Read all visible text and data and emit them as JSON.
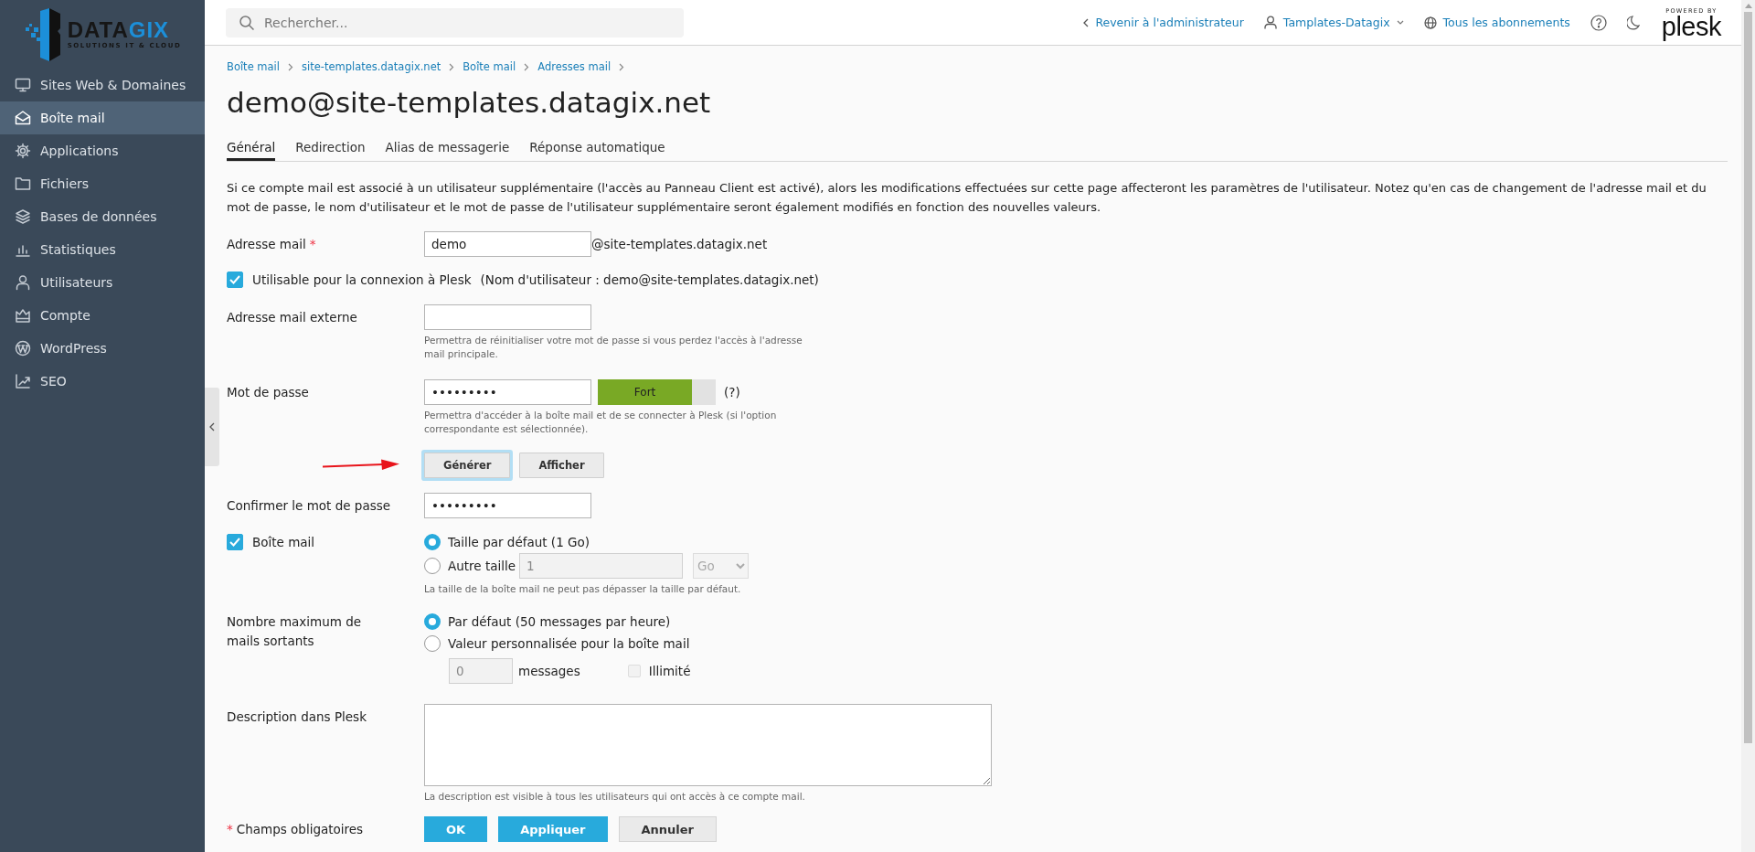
{
  "sidebar": {
    "logo": {
      "wordmark": [
        "DATA",
        "GIX"
      ],
      "tagline": "SOLUTIONS IT & CLOUD"
    },
    "items": [
      {
        "label": "Sites Web & Domaines",
        "selected": false
      },
      {
        "label": "Boîte mail",
        "selected": true
      },
      {
        "label": "Applications",
        "selected": false
      },
      {
        "label": "Fichiers",
        "selected": false
      },
      {
        "label": "Bases de données",
        "selected": false
      },
      {
        "label": "Statistiques",
        "selected": false
      },
      {
        "label": "Utilisateurs",
        "selected": false
      },
      {
        "label": "Compte",
        "selected": false
      },
      {
        "label": "WordPress",
        "selected": false
      },
      {
        "label": "SEO",
        "selected": false
      }
    ]
  },
  "topbar": {
    "search_placeholder": "Rechercher...",
    "links": [
      {
        "kind": "back",
        "label": "Revenir à l'administrateur"
      },
      {
        "kind": "user",
        "label": "Tamplates-Datagix"
      },
      {
        "kind": "globe",
        "label": "Tous les abonnements"
      }
    ],
    "powered_by": "POWERED BY",
    "brand": "plesk"
  },
  "breadcrumbs": [
    "Boîte mail",
    "site-templates.datagix.net",
    "Boîte mail",
    "Adresses mail"
  ],
  "title": "demo@site-templates.datagix.net",
  "tabs": [
    {
      "label": "Général",
      "selected": true
    },
    {
      "label": "Redirection",
      "selected": false
    },
    {
      "label": "Alias de messagerie",
      "selected": false
    },
    {
      "label": "Réponse automatique",
      "selected": false
    }
  ],
  "intro": "Si ce compte mail est associé à un utilisateur supplémentaire (l'accès au Panneau Client est activé), alors les modifications effectuées sur cette page affecteront les paramètres de l'utilisateur. Notez qu'en cas de changement de l'adresse mail et du mot de passe, le nom d'utilisateur et le mot de passe de l'utilisateur supplémentaire seront également modifiés en fonction des nouvelles valeurs.",
  "form": {
    "email": {
      "label": "Adresse mail",
      "required_mark": "*",
      "value": "demo",
      "domain": "@site-templates.datagix.net"
    },
    "login_checkbox": {
      "label": "Utilisable pour la connexion à Plesk",
      "note": "(Nom d'utilisateur : demo@site-templates.datagix.net)",
      "checked": true
    },
    "external": {
      "label": "Adresse mail externe",
      "hint": "Permettra de réinitialiser votre mot de passe si vous perdez l'accès à l'adresse mail principale."
    },
    "password": {
      "label": "Mot de passe",
      "value": "•••••••••",
      "strength": {
        "label": "Fort",
        "level": 0.8
      },
      "help": "(?)",
      "hint": "Permettra d'accéder à la boîte mail et de se connecter à Plesk (si l'option correspondante est sélectionnée)."
    },
    "password_buttons": [
      {
        "label": "Générer",
        "focused": true
      },
      {
        "label": "Afficher",
        "focused": false
      }
    ],
    "confirm": {
      "label": "Confirmer le mot de passe",
      "value": "•••••••••"
    },
    "mailbox": {
      "label": "Boîte mail",
      "checked": true,
      "options": [
        {
          "label": "Taille par défaut (1 Go)",
          "selected": true
        },
        {
          "label": "Autre taille",
          "selected": false
        }
      ],
      "size": "1",
      "unit": "Go",
      "hint": "La taille de la boîte mail ne peut pas dépasser la taille par défaut."
    },
    "outgoing": {
      "label": "Nombre maximum de mails sortants",
      "options": [
        {
          "label": "Par défaut (50 messages par heure)",
          "selected": true
        },
        {
          "label": "Valeur personnalisée pour la boîte mail",
          "selected": false
        }
      ],
      "count": "0",
      "count_unit": "messages",
      "unlimited": {
        "label": "Illimité",
        "checked": false
      }
    },
    "description": {
      "label": "Description dans Plesk",
      "hint": "La description est visible à tous les utilisateurs qui ont accès à ce compte mail."
    },
    "required_note": {
      "mark": "*",
      "text": "Champs obligatoires"
    },
    "buttons": [
      {
        "kind": "primary",
        "label": "OK"
      },
      {
        "kind": "primary",
        "label": "Appliquer"
      },
      {
        "kind": "secondary",
        "label": "Annuler"
      }
    ]
  }
}
